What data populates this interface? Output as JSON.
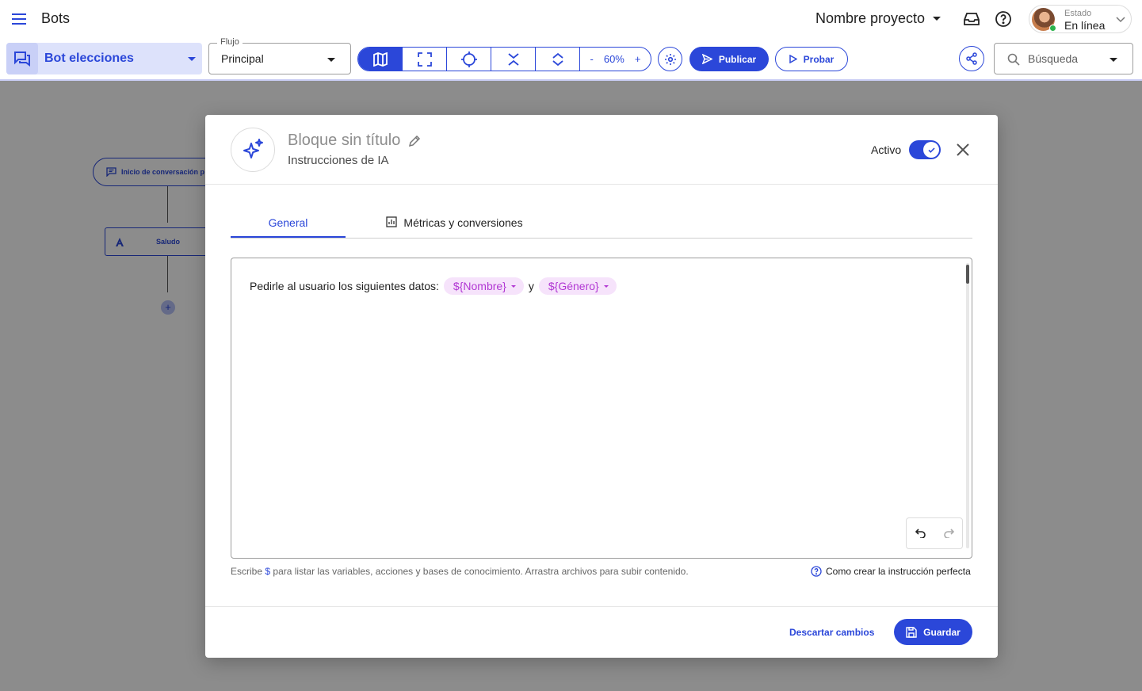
{
  "header": {
    "app_title": "Bots",
    "project_name": "Nombre proyecto",
    "status_label": "Estado",
    "status_value": "En línea"
  },
  "toolbar": {
    "bot_name": "Bot elecciones",
    "flow_legend": "Flujo",
    "flow_value": "Principal",
    "zoom_minus": "-",
    "zoom_level": "60%",
    "zoom_plus": "+",
    "publish_label": "Publicar",
    "test_label": "Probar",
    "search_placeholder": "Búsqueda"
  },
  "canvas": {
    "start_node_label": "Inicio de conversación p",
    "greeting_node_label": "Saludo",
    "add_node_label": "+"
  },
  "modal": {
    "title": "Bloque sin título",
    "subtitle": "Instrucciones de IA",
    "active_label": "Activo",
    "active": true,
    "tabs": [
      {
        "label": "General",
        "selected": true
      },
      {
        "label": "Métricas y conversiones",
        "selected": false
      }
    ],
    "editor": {
      "text_before": "Pedirle al usuario los siguientes datos:",
      "var_1": "${Nombre}",
      "connector": "y",
      "var_2": "${Género}"
    },
    "helper_prefix": "Escribe",
    "helper_symbol": "$",
    "helper_suffix": "para listar las variables, acciones y bases de conocimiento. Arrastra archivos para subir contenido.",
    "help_link": "Como crear la instrucción perfecta",
    "discard_label": "Descartar cambios",
    "save_label": "Guardar"
  },
  "colors": {
    "primary": "#2b47d9",
    "variable_chip_bg": "#f6e3fb",
    "variable_chip_text": "#b137d3",
    "online": "#2bb24c"
  },
  "icons": [
    "menu-icon",
    "inbox-icon",
    "help-icon",
    "chevron-down-icon",
    "chat-bubbles-icon",
    "map-icon",
    "fullscreen-icon",
    "crosshair-icon",
    "collapse-icon",
    "expand-icon",
    "gear-icon",
    "send-icon",
    "play-icon",
    "share-icon",
    "search-icon",
    "sparkles-icon",
    "pencil-icon",
    "check-icon",
    "close-icon",
    "bar-chart-icon",
    "undo-icon",
    "redo-icon",
    "question-circle-icon",
    "save-icon"
  ]
}
